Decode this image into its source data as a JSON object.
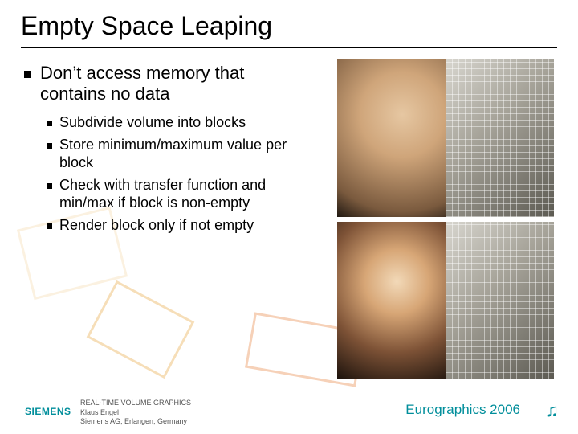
{
  "title": "Empty Space Leaping",
  "bullets": {
    "main": "Don’t access memory that contains no data",
    "sub": [
      "Subdivide volume into blocks",
      "Store minimum/maximum value per block",
      "Check with transfer function and min/max if block is non-empty",
      "Render block only if not empty"
    ]
  },
  "footer": {
    "logo": "SIEMENS",
    "line1": "REAL-TIME VOLUME GRAPHICS",
    "line2": "Klaus Engel",
    "line3": "Siemens AG, Erlangen, Germany",
    "conference": "Eurographics 2006",
    "note_glyph": "♫"
  },
  "images": {
    "top_alt": "Volume rendering of a head: left smooth surface, right showing wireframe block grid",
    "bottom_alt": "Volume rendering of a skull: left smooth surface, right showing wireframe block grid"
  }
}
